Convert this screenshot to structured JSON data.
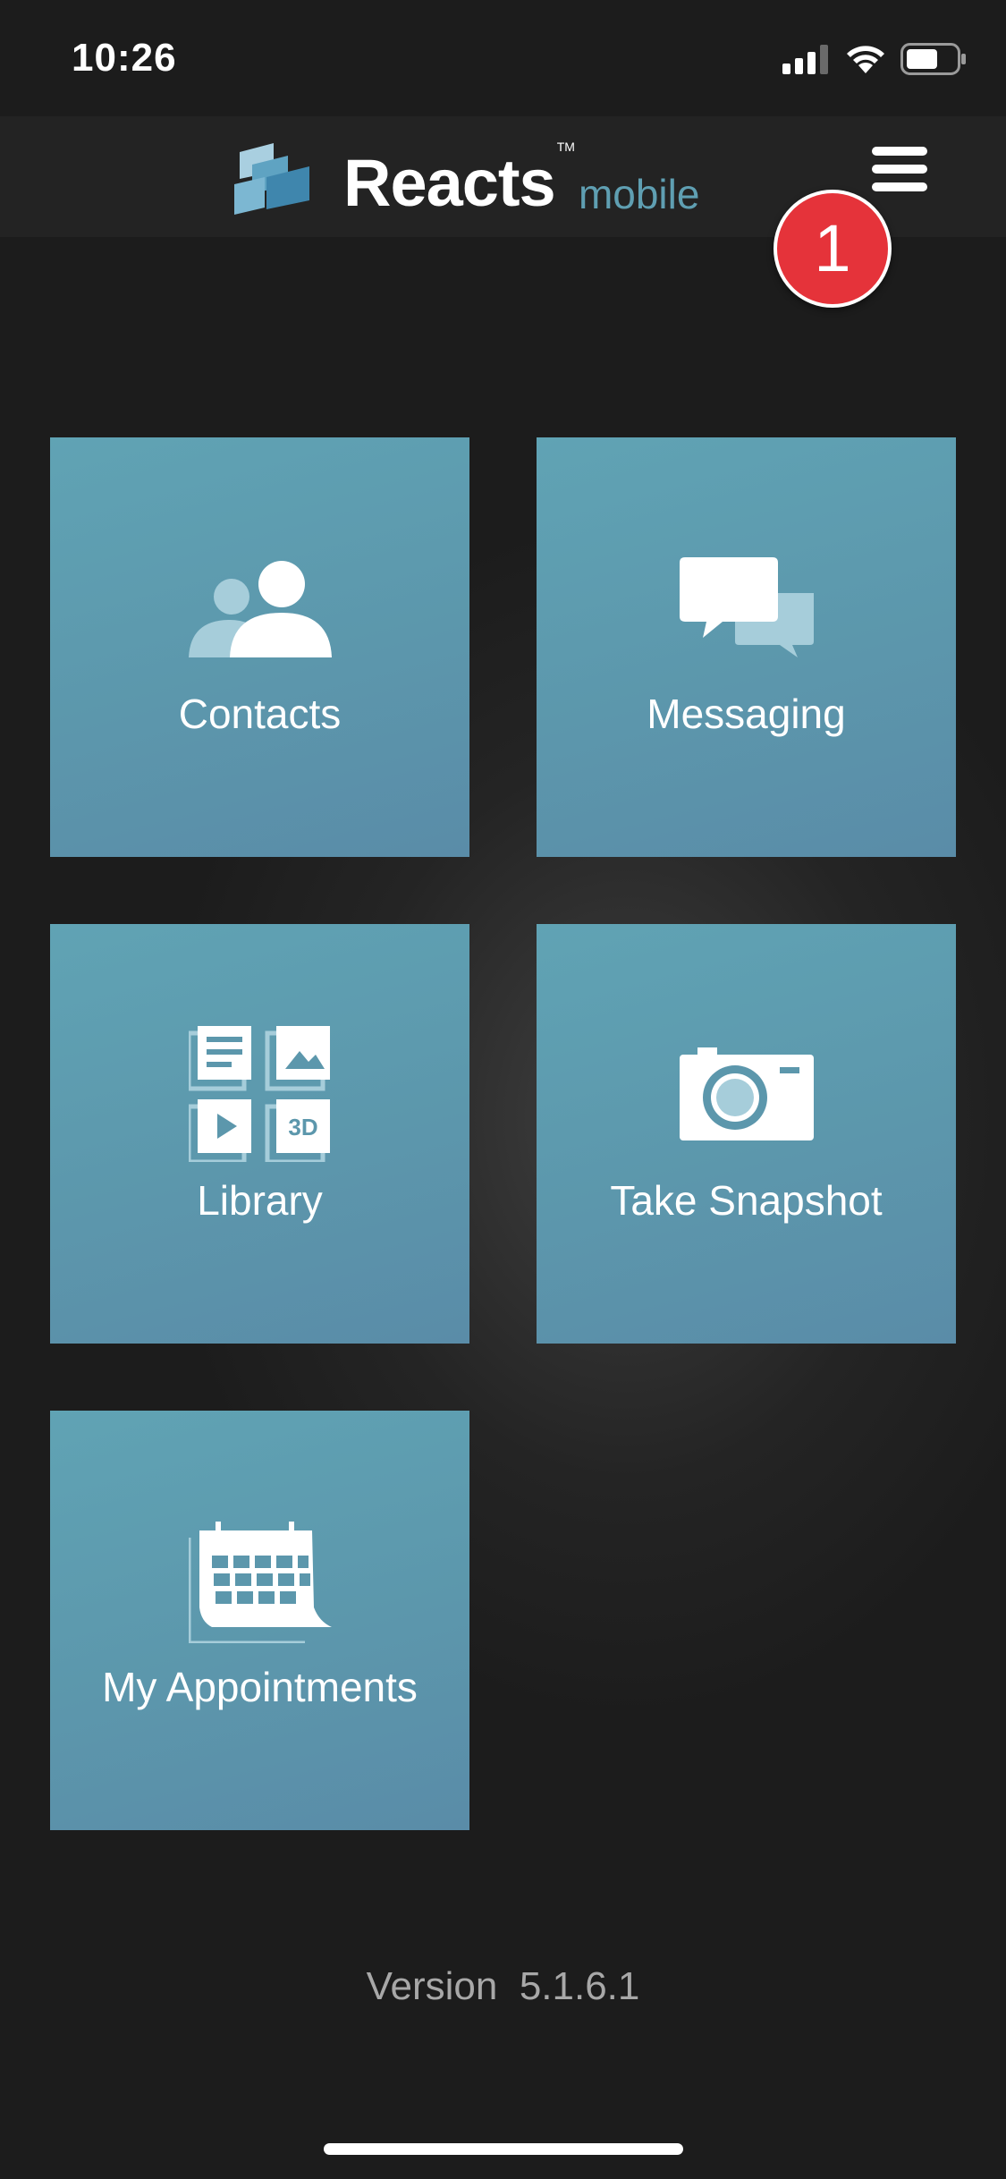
{
  "status_bar": {
    "time": "10:26",
    "icons": [
      "cellular-signal-icon",
      "wifi-icon",
      "battery-icon"
    ]
  },
  "header": {
    "logo_word": "Reacts",
    "logo_tm": "TM",
    "logo_sub": "mobile",
    "menu_icon": "hamburger-menu-icon",
    "badge_count": "1"
  },
  "tiles": [
    {
      "label": "Contacts",
      "icon": "contacts-icon"
    },
    {
      "label": "Messaging",
      "icon": "messaging-icon"
    },
    {
      "label": "Library",
      "icon": "library-icon"
    },
    {
      "label": "Take Snapshot",
      "icon": "camera-icon"
    },
    {
      "label": "My Appointments",
      "icon": "calendar-icon"
    }
  ],
  "footer": {
    "version": "Version  5.1.6.1"
  },
  "colors": {
    "background": "#1c1c1c",
    "header": "#232323",
    "tile": "#5c97ac",
    "accent": "#5f9fb2",
    "badge": "#e5333a"
  }
}
